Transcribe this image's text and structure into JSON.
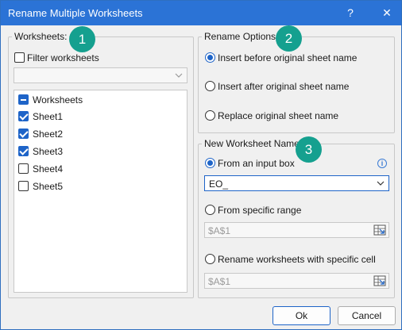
{
  "window": {
    "title": "Rename Multiple Worksheets",
    "help_label": "?",
    "close_label": "✕"
  },
  "worksheets_group": {
    "legend": "Worksheets:",
    "badge": "1",
    "filter": {
      "label": "Filter worksheets",
      "checked": false,
      "value": ""
    },
    "items": [
      {
        "label": "Worksheets",
        "state": "partial"
      },
      {
        "label": "Sheet1",
        "state": "checked"
      },
      {
        "label": "Sheet2",
        "state": "checked"
      },
      {
        "label": "Sheet3",
        "state": "checked"
      },
      {
        "label": "Sheet4",
        "state": "unchecked"
      },
      {
        "label": "Sheet5",
        "state": "unchecked"
      }
    ]
  },
  "rename_options": {
    "legend": "Rename Options:",
    "badge": "2",
    "options": [
      {
        "label": "Insert before original sheet name",
        "selected": true
      },
      {
        "label": "Insert after original sheet name",
        "selected": false
      },
      {
        "label": "Replace original sheet name",
        "selected": false
      }
    ]
  },
  "new_name": {
    "legend": "New Worksheet Name:",
    "badge": "3",
    "from_input": {
      "label": "From an input box",
      "selected": true,
      "value": "EO_"
    },
    "from_range": {
      "label": "From specific range",
      "selected": false,
      "value": "$A$1"
    },
    "from_cell": {
      "label": "Rename worksheets with specific cell",
      "selected": false,
      "value": "$A$1"
    },
    "info_icon": "i"
  },
  "footer": {
    "ok_label": "Ok",
    "cancel_label": "Cancel"
  },
  "colors": {
    "titlebar": "#2b73d6",
    "accent": "#1e64c8",
    "badge": "#15a08f"
  }
}
